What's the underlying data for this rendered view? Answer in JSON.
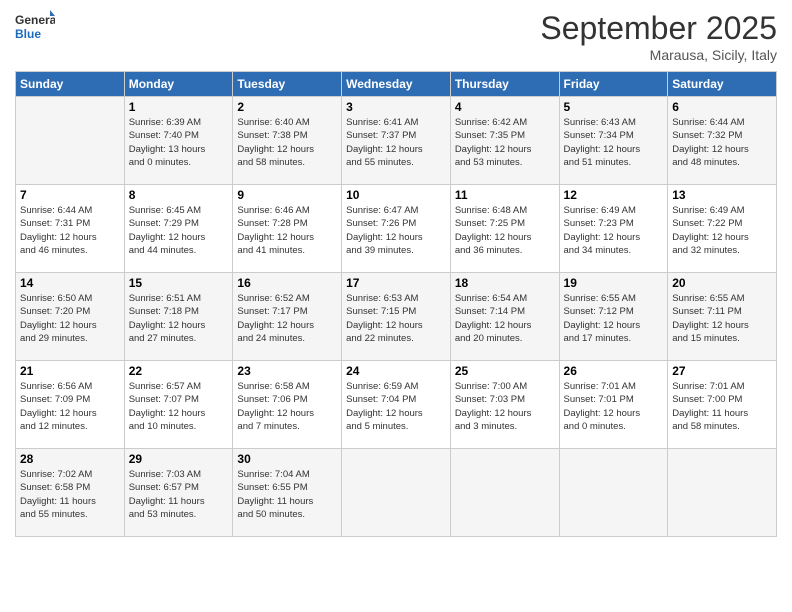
{
  "header": {
    "logo_line1": "General",
    "logo_line2": "Blue",
    "month": "September 2025",
    "location": "Marausa, Sicily, Italy"
  },
  "days_of_week": [
    "Sunday",
    "Monday",
    "Tuesday",
    "Wednesday",
    "Thursday",
    "Friday",
    "Saturday"
  ],
  "weeks": [
    [
      {
        "day": "",
        "info": ""
      },
      {
        "day": "1",
        "info": "Sunrise: 6:39 AM\nSunset: 7:40 PM\nDaylight: 13 hours\nand 0 minutes."
      },
      {
        "day": "2",
        "info": "Sunrise: 6:40 AM\nSunset: 7:38 PM\nDaylight: 12 hours\nand 58 minutes."
      },
      {
        "day": "3",
        "info": "Sunrise: 6:41 AM\nSunset: 7:37 PM\nDaylight: 12 hours\nand 55 minutes."
      },
      {
        "day": "4",
        "info": "Sunrise: 6:42 AM\nSunset: 7:35 PM\nDaylight: 12 hours\nand 53 minutes."
      },
      {
        "day": "5",
        "info": "Sunrise: 6:43 AM\nSunset: 7:34 PM\nDaylight: 12 hours\nand 51 minutes."
      },
      {
        "day": "6",
        "info": "Sunrise: 6:44 AM\nSunset: 7:32 PM\nDaylight: 12 hours\nand 48 minutes."
      }
    ],
    [
      {
        "day": "7",
        "info": "Sunrise: 6:44 AM\nSunset: 7:31 PM\nDaylight: 12 hours\nand 46 minutes."
      },
      {
        "day": "8",
        "info": "Sunrise: 6:45 AM\nSunset: 7:29 PM\nDaylight: 12 hours\nand 44 minutes."
      },
      {
        "day": "9",
        "info": "Sunrise: 6:46 AM\nSunset: 7:28 PM\nDaylight: 12 hours\nand 41 minutes."
      },
      {
        "day": "10",
        "info": "Sunrise: 6:47 AM\nSunset: 7:26 PM\nDaylight: 12 hours\nand 39 minutes."
      },
      {
        "day": "11",
        "info": "Sunrise: 6:48 AM\nSunset: 7:25 PM\nDaylight: 12 hours\nand 36 minutes."
      },
      {
        "day": "12",
        "info": "Sunrise: 6:49 AM\nSunset: 7:23 PM\nDaylight: 12 hours\nand 34 minutes."
      },
      {
        "day": "13",
        "info": "Sunrise: 6:49 AM\nSunset: 7:22 PM\nDaylight: 12 hours\nand 32 minutes."
      }
    ],
    [
      {
        "day": "14",
        "info": "Sunrise: 6:50 AM\nSunset: 7:20 PM\nDaylight: 12 hours\nand 29 minutes."
      },
      {
        "day": "15",
        "info": "Sunrise: 6:51 AM\nSunset: 7:18 PM\nDaylight: 12 hours\nand 27 minutes."
      },
      {
        "day": "16",
        "info": "Sunrise: 6:52 AM\nSunset: 7:17 PM\nDaylight: 12 hours\nand 24 minutes."
      },
      {
        "day": "17",
        "info": "Sunrise: 6:53 AM\nSunset: 7:15 PM\nDaylight: 12 hours\nand 22 minutes."
      },
      {
        "day": "18",
        "info": "Sunrise: 6:54 AM\nSunset: 7:14 PM\nDaylight: 12 hours\nand 20 minutes."
      },
      {
        "day": "19",
        "info": "Sunrise: 6:55 AM\nSunset: 7:12 PM\nDaylight: 12 hours\nand 17 minutes."
      },
      {
        "day": "20",
        "info": "Sunrise: 6:55 AM\nSunset: 7:11 PM\nDaylight: 12 hours\nand 15 minutes."
      }
    ],
    [
      {
        "day": "21",
        "info": "Sunrise: 6:56 AM\nSunset: 7:09 PM\nDaylight: 12 hours\nand 12 minutes."
      },
      {
        "day": "22",
        "info": "Sunrise: 6:57 AM\nSunset: 7:07 PM\nDaylight: 12 hours\nand 10 minutes."
      },
      {
        "day": "23",
        "info": "Sunrise: 6:58 AM\nSunset: 7:06 PM\nDaylight: 12 hours\nand 7 minutes."
      },
      {
        "day": "24",
        "info": "Sunrise: 6:59 AM\nSunset: 7:04 PM\nDaylight: 12 hours\nand 5 minutes."
      },
      {
        "day": "25",
        "info": "Sunrise: 7:00 AM\nSunset: 7:03 PM\nDaylight: 12 hours\nand 3 minutes."
      },
      {
        "day": "26",
        "info": "Sunrise: 7:01 AM\nSunset: 7:01 PM\nDaylight: 12 hours\nand 0 minutes."
      },
      {
        "day": "27",
        "info": "Sunrise: 7:01 AM\nSunset: 7:00 PM\nDaylight: 11 hours\nand 58 minutes."
      }
    ],
    [
      {
        "day": "28",
        "info": "Sunrise: 7:02 AM\nSunset: 6:58 PM\nDaylight: 11 hours\nand 55 minutes."
      },
      {
        "day": "29",
        "info": "Sunrise: 7:03 AM\nSunset: 6:57 PM\nDaylight: 11 hours\nand 53 minutes."
      },
      {
        "day": "30",
        "info": "Sunrise: 7:04 AM\nSunset: 6:55 PM\nDaylight: 11 hours\nand 50 minutes."
      },
      {
        "day": "",
        "info": ""
      },
      {
        "day": "",
        "info": ""
      },
      {
        "day": "",
        "info": ""
      },
      {
        "day": "",
        "info": ""
      }
    ]
  ]
}
